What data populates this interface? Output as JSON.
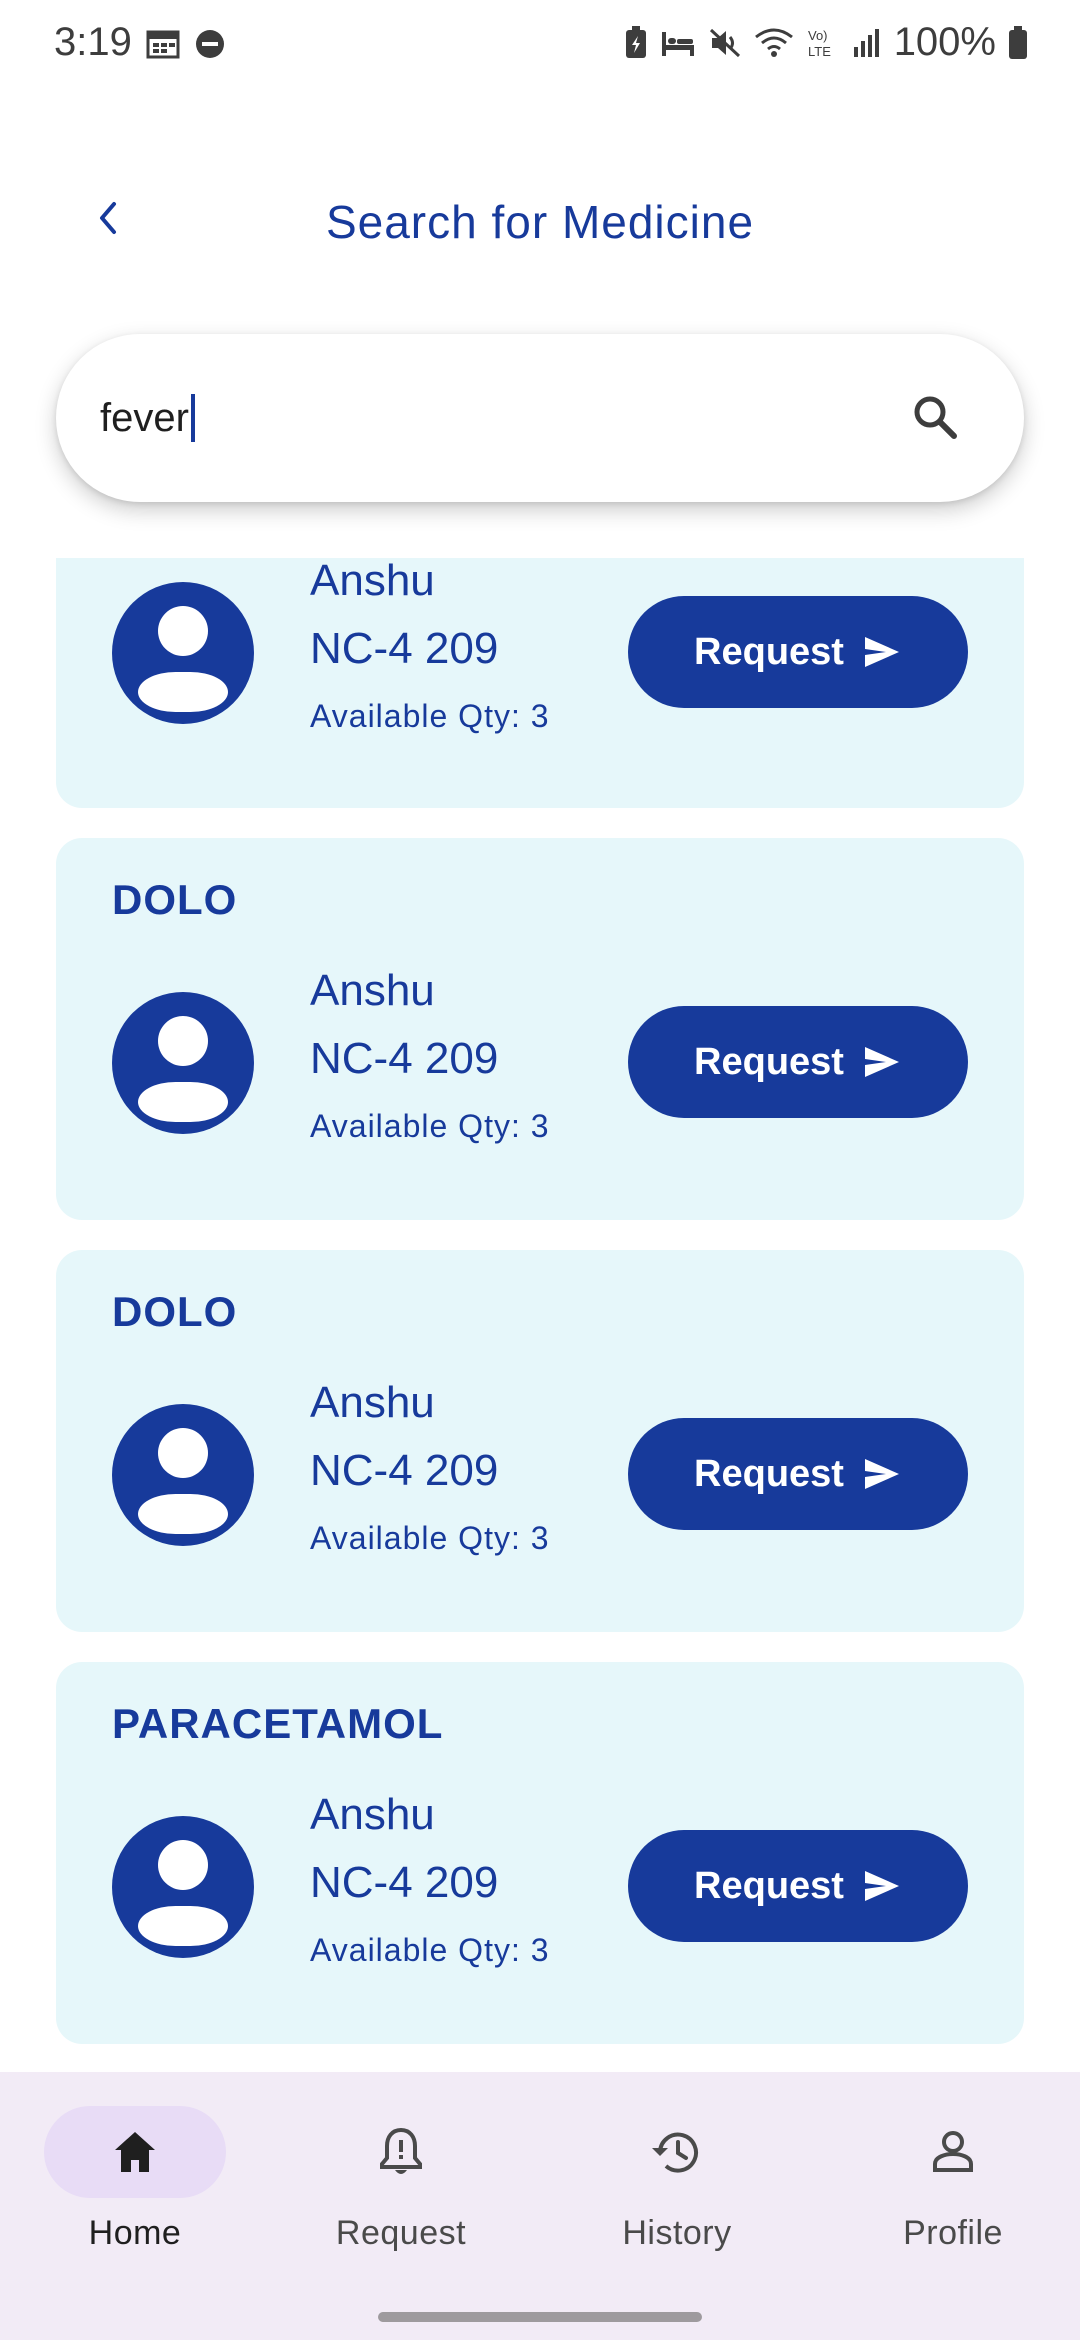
{
  "status_bar": {
    "time": "3:19",
    "battery": "100%"
  },
  "header": {
    "title": "Search for Medicine"
  },
  "search": {
    "value": "fever"
  },
  "cards": [
    {
      "medicine": "",
      "seller": "Anshu",
      "room": "NC-4 209",
      "qty": "Available Qty: 3",
      "button": "Request"
    },
    {
      "medicine": "DOLO",
      "seller": "Anshu",
      "room": "NC-4 209",
      "qty": "Available Qty: 3",
      "button": "Request"
    },
    {
      "medicine": "DOLO",
      "seller": "Anshu",
      "room": "NC-4 209",
      "qty": "Available Qty: 3",
      "button": "Request"
    },
    {
      "medicine": "PARACETAMOL",
      "seller": "Anshu",
      "room": "NC-4 209",
      "qty": "Available Qty: 3",
      "button": "Request"
    }
  ],
  "nav": {
    "items": [
      {
        "label": "Home",
        "icon": "home-icon",
        "active": true
      },
      {
        "label": "Request",
        "icon": "bell-icon",
        "active": false
      },
      {
        "label": "History",
        "icon": "history-icon",
        "active": false
      },
      {
        "label": "Profile",
        "icon": "person-icon",
        "active": false
      }
    ]
  },
  "colors": {
    "primary": "#173a9b",
    "card_bg": "#e6f7fa",
    "nav_bg": "#f2ebf6",
    "nav_active_pill": "#e8dcf6"
  }
}
